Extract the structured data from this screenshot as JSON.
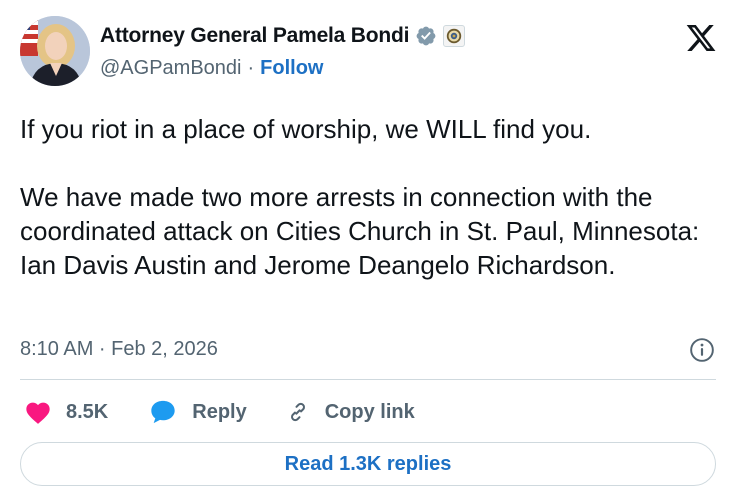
{
  "author": {
    "name": "Attorney General Pamela Bondi",
    "handle": "@AGPamBondi",
    "separator": "·",
    "follow_label": "Follow"
  },
  "tweet": {
    "line1": "If you riot in a place of worship, we WILL find you.",
    "line2": "We have made two more arrests in connection with the coordinated attack on Cities Church in St. Paul, Minnesota: Ian Davis Austin and Jerome Deangelo Richardson."
  },
  "meta": {
    "timestamp": "8:10 AM · Feb 2, 2026"
  },
  "actions": {
    "like_count": "8.5K",
    "reply_label": "Reply",
    "copy_label": "Copy link"
  },
  "replies_button": "Read 1.3K replies",
  "colors": {
    "link_blue": "#1d70c4",
    "heart_pink": "#f91880",
    "reply_blue": "#1d9bf0",
    "muted": "#536471",
    "text": "#0f1419",
    "border": "#cfd9de"
  }
}
